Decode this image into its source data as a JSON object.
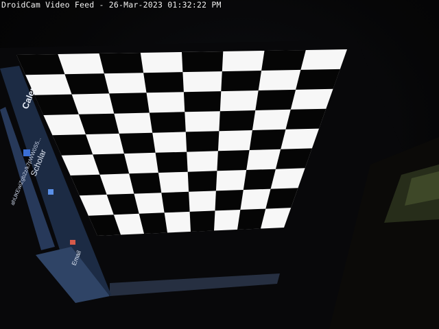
{
  "overlay": {
    "title": "DroidCam Video Feed - 26-Mar-2023 01:32:22 PM"
  },
  "scene": {
    "board": {
      "rows": 9,
      "cols": 8,
      "light_color": "#f7f7f7",
      "dark_color": "#050505"
    },
    "browser_sidebar": {
      "bookmarks": [
        {
          "label": "Calendar",
          "icon": "calendar-icon"
        },
        {
          "label": "Scholar",
          "icon": "scholar-icon"
        },
        {
          "label": "Email",
          "icon": "mail-icon"
        }
      ],
      "url_fragment": "ahUKEwiZgb2z/k7pWW0S5...",
      "colors": {
        "bar": "#2a3a55",
        "text": "#dfe6f2"
      }
    }
  }
}
